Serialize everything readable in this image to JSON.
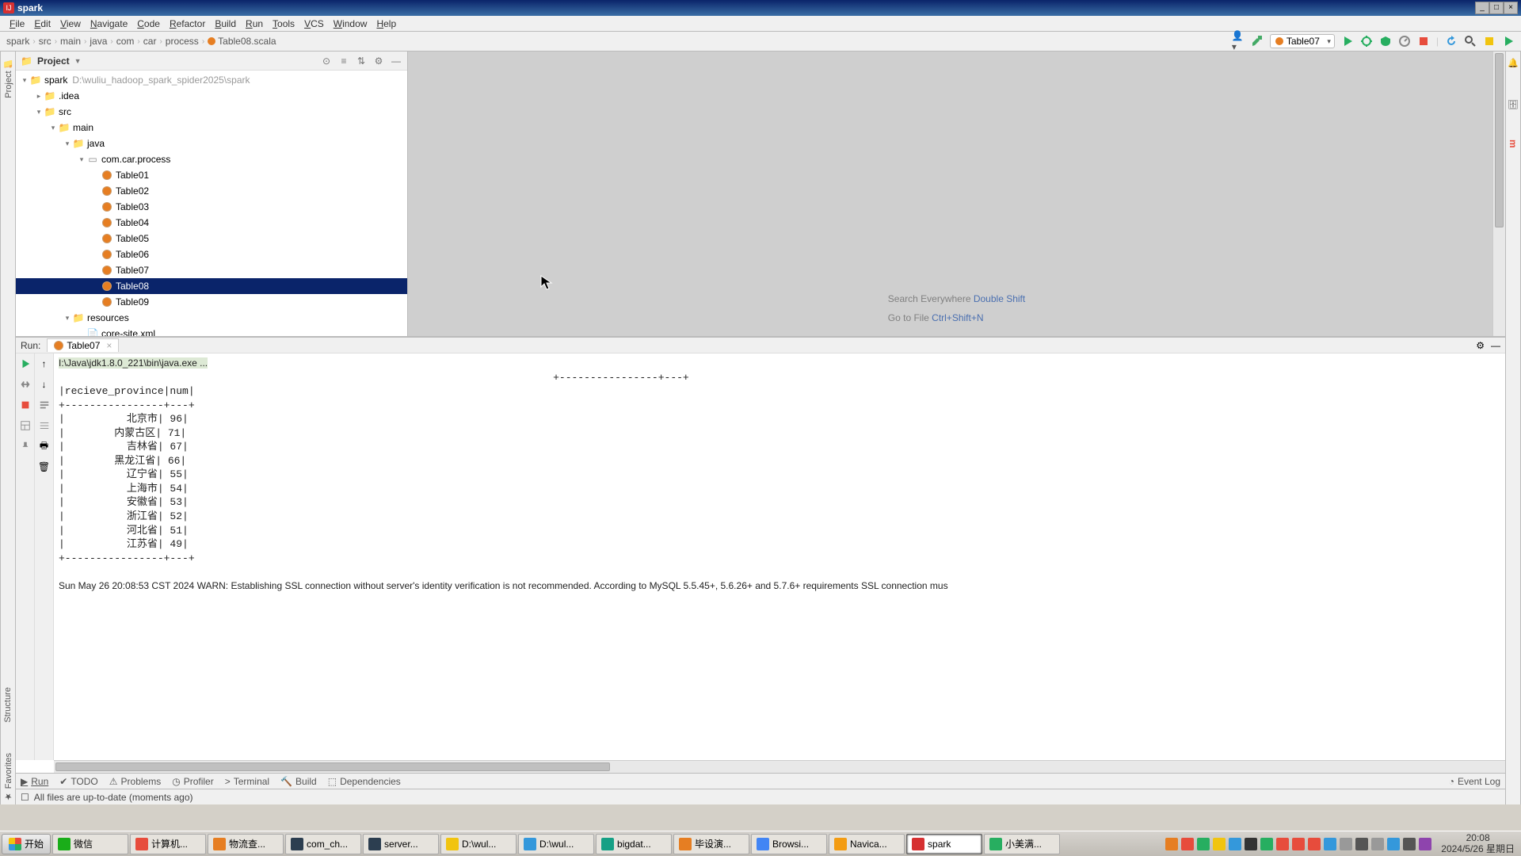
{
  "window": {
    "title": "spark"
  },
  "menubar": [
    "File",
    "Edit",
    "View",
    "Navigate",
    "Code",
    "Refactor",
    "Build",
    "Run",
    "Tools",
    "VCS",
    "Window",
    "Help"
  ],
  "breadcrumb": {
    "items": [
      "spark",
      "src",
      "main",
      "java",
      "com",
      "car",
      "process"
    ],
    "file": "Table08.scala"
  },
  "run_config": {
    "selected": "Table07"
  },
  "project_panel": {
    "title": "Project",
    "root": {
      "name": "spark",
      "path": "D:\\wuliu_hadoop_spark_spider2025\\spark"
    },
    "tree": [
      {
        "depth": 0,
        "twisty": "▾",
        "icon": "folder",
        "label": "spark",
        "subpath": "D:\\wuliu_hadoop_spark_spider2025\\spark"
      },
      {
        "depth": 1,
        "twisty": "▸",
        "icon": "folder",
        "label": ".idea"
      },
      {
        "depth": 1,
        "twisty": "▾",
        "icon": "folder-blue",
        "label": "src"
      },
      {
        "depth": 2,
        "twisty": "▾",
        "icon": "folder-blue",
        "label": "main"
      },
      {
        "depth": 3,
        "twisty": "▾",
        "icon": "folder-blue",
        "label": "java"
      },
      {
        "depth": 4,
        "twisty": "▾",
        "icon": "pkg",
        "label": "com.car.process"
      },
      {
        "depth": 5,
        "twisty": "",
        "icon": "scala",
        "label": "Table01"
      },
      {
        "depth": 5,
        "twisty": "",
        "icon": "scala",
        "label": "Table02"
      },
      {
        "depth": 5,
        "twisty": "",
        "icon": "scala",
        "label": "Table03"
      },
      {
        "depth": 5,
        "twisty": "",
        "icon": "scala",
        "label": "Table04"
      },
      {
        "depth": 5,
        "twisty": "",
        "icon": "scala",
        "label": "Table05"
      },
      {
        "depth": 5,
        "twisty": "",
        "icon": "scala",
        "label": "Table06"
      },
      {
        "depth": 5,
        "twisty": "",
        "icon": "scala",
        "label": "Table07"
      },
      {
        "depth": 5,
        "twisty": "",
        "icon": "scala",
        "label": "Table08",
        "selected": true
      },
      {
        "depth": 5,
        "twisty": "",
        "icon": "scala",
        "label": "Table09"
      },
      {
        "depth": 3,
        "twisty": "▾",
        "icon": "folder-res",
        "label": "resources"
      },
      {
        "depth": 4,
        "twisty": "",
        "icon": "xml",
        "label": "core-site.xml"
      }
    ]
  },
  "editor_hints": {
    "line1_pre": "Search Everywhere ",
    "line1_key": "Double Shift",
    "line2_pre": "Go to File ",
    "line2_key": "Ctrl+Shift+N"
  },
  "run_panel": {
    "label": "Run:",
    "tab": "Table07",
    "cmd_line": "I:\\Java\\jdk1.8.0_221\\bin\\java.exe ...",
    "sep_right": "+----------------+---+",
    "header": "|recieve_province|num|",
    "sep": "+----------------+---+",
    "rows": [
      "|          北京市| 96|",
      "|        内蒙古区| 71|",
      "|          吉林省| 67|",
      "|        黑龙江省| 66|",
      "|          辽宁省| 55|",
      "|          上海市| 54|",
      "|          安徽省| 53|",
      "|          浙江省| 52|",
      "|          河北省| 51|",
      "|          江苏省| 49|"
    ],
    "sep2": "+----------------+---+",
    "warn": "Sun May 26 20:08:53 CST 2024 WARN: Establishing SSL connection without server's identity verification is not recommended. According to MySQL 5.5.45+, 5.6.26+ and 5.7.6+ requirements SSL connection mus"
  },
  "bottom_tabs": [
    "Run",
    "TODO",
    "Problems",
    "Profiler",
    "Terminal",
    "Build",
    "Dependencies"
  ],
  "bottom_right": "Event Log",
  "status_bar": {
    "msg": "All files are up-to-date (moments ago)"
  },
  "taskbar": {
    "start": "开始",
    "items": [
      {
        "label": "微信",
        "color": "#1aad19"
      },
      {
        "label": "计算机...",
        "color": "#e74c3c"
      },
      {
        "label": "物流查...",
        "color": "#e67e22"
      },
      {
        "label": "com_ch...",
        "color": "#2c3e50"
      },
      {
        "label": "server...",
        "color": "#2c3e50"
      },
      {
        "label": "D:\\wul...",
        "color": "#f1c40f"
      },
      {
        "label": "D:\\wul...",
        "color": "#3498db"
      },
      {
        "label": "bigdat...",
        "color": "#16a085"
      },
      {
        "label": "毕设演...",
        "color": "#e67e22"
      },
      {
        "label": "Browsi...",
        "color": "#4285f4"
      },
      {
        "label": "Navica...",
        "color": "#f39c12"
      },
      {
        "label": "spark",
        "color": "#d63031",
        "active": true
      },
      {
        "label": "小美满...",
        "color": "#27ae60"
      }
    ],
    "tray_colors": [
      "#e67e22",
      "#e74c3c",
      "#27ae60",
      "#f1c40f",
      "#3498db",
      "#333",
      "#27ae60",
      "#e74c3c",
      "#e74c3c",
      "#e74c3c",
      "#3498db",
      "#999",
      "#555",
      "#999",
      "#3498db",
      "#555",
      "#8e44ad"
    ],
    "clock": {
      "time": "20:08",
      "date": "2024/5/26 星期日"
    }
  }
}
